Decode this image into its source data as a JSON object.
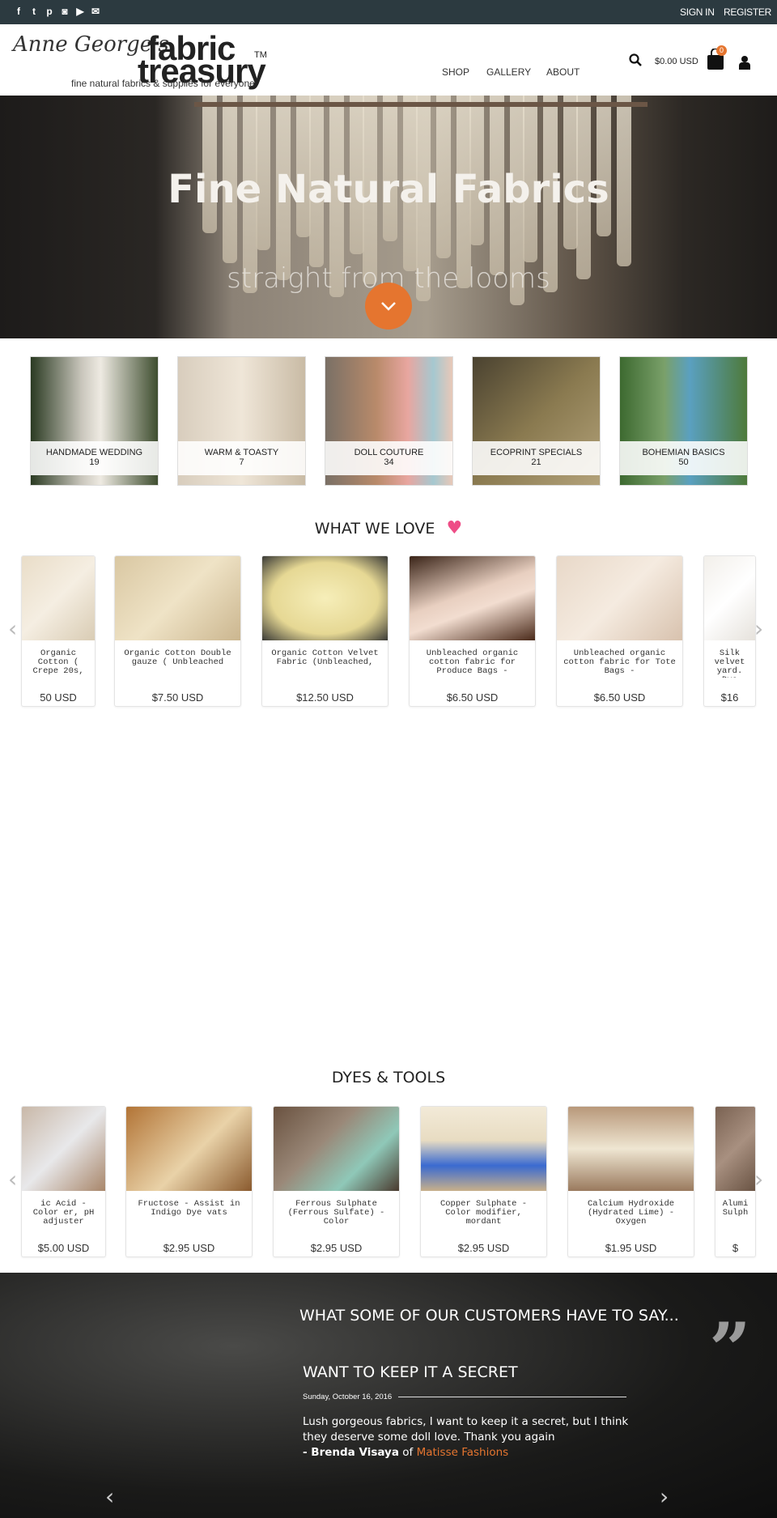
{
  "topbar": {
    "social": [
      {
        "icon": "facebook-icon",
        "glyph": "f"
      },
      {
        "icon": "twitter-icon",
        "glyph": "t"
      },
      {
        "icon": "pinterest-icon",
        "glyph": "p"
      },
      {
        "icon": "instagram-icon",
        "glyph": "◙"
      },
      {
        "icon": "youtube-icon",
        "glyph": "▶"
      },
      {
        "icon": "email-icon",
        "glyph": "✉"
      }
    ],
    "sign_in": "SIGN IN",
    "register": "REGISTER"
  },
  "header": {
    "logo_script": "Anne George's",
    "logo_word1": "fabric",
    "logo_word2": "treasury",
    "logo_tm": "TM",
    "tagline": "fine natural fabrics & supplies for everyone",
    "nav": [
      "SHOP",
      "GALLERY",
      "ABOUT"
    ],
    "cart_total": "$0.00 USD",
    "cart_count": "0"
  },
  "hero": {
    "title": "Fine Natural Fabrics",
    "subtitle": "straight from the looms",
    "accent": "#e5752f"
  },
  "categories": [
    {
      "name": "HANDMADE WEDDING",
      "count": "19"
    },
    {
      "name": "WARM & TOASTY",
      "count": "7"
    },
    {
      "name": "DOLL COUTURE",
      "count": "34"
    },
    {
      "name": "ECOPRINT SPECIALS",
      "count": "21"
    },
    {
      "name": "BOHEMIAN BASICS",
      "count": "50"
    }
  ],
  "love": {
    "title": "WHAT WE LOVE",
    "heart_color": "#ee4d86",
    "products": [
      {
        "name": "Organic Cotton ( Crepe 20s,",
        "price": "50 USD"
      },
      {
        "name": "Organic Cotton Double gauze ( Unbleached",
        "price": "$7.50 USD"
      },
      {
        "name": "Organic Cotton Velvet Fabric (Unbleached,",
        "price": "$12.50 USD"
      },
      {
        "name": "Unbleached organic cotton fabric for Produce Bags -",
        "price": "$6.50 USD"
      },
      {
        "name": "Unbleached organic cotton fabric for Tote Bags -",
        "price": "$6.50 USD"
      },
      {
        "name": "Silk velvet yard. Dye",
        "price": "$16"
      }
    ]
  },
  "dyes": {
    "title": "DYES & TOOLS",
    "products": [
      {
        "name": "ic Acid - Color er, pH adjuster",
        "price": "$5.00 USD"
      },
      {
        "name": "Fructose - Assist in Indigo Dye vats",
        "price": "$2.95 USD"
      },
      {
        "name": "Ferrous Sulphate (Ferrous Sulfate) - Color",
        "price": "$2.95 USD"
      },
      {
        "name": "Copper Sulphate - Color modifier, mordant",
        "price": "$2.95 USD"
      },
      {
        "name": "Calcium Hydroxide (Hydrated Lime) - Oxygen",
        "price": "$1.95 USD"
      },
      {
        "name": "Alumi Sulph",
        "price": "$"
      }
    ]
  },
  "testimonials": {
    "heading": "WHAT SOME OF OUR CUSTOMERS HAVE TO SAY...",
    "title": "WANT TO KEEP IT A SECRET",
    "date": "Sunday, October 16, 2016",
    "text": "Lush gorgeous fabrics, I want to keep it a secret, but I think they deserve some doll love. Thank you again",
    "author": "- Brenda Visaya",
    "of": "of",
    "company": "Matisse Fashions",
    "link_color": "#e5752f"
  }
}
